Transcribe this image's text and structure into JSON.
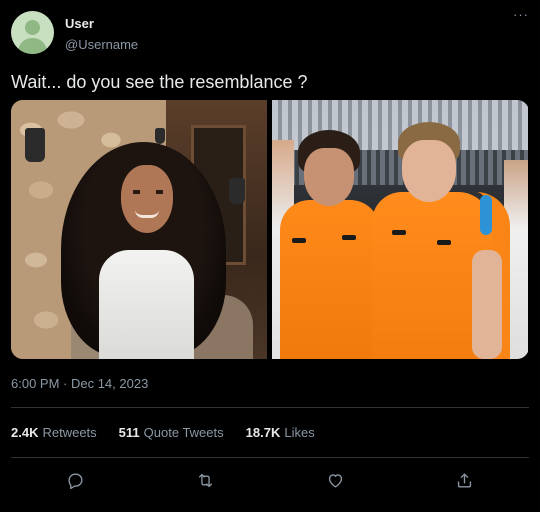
{
  "user": {
    "display_name": "User",
    "handle": "@Username",
    "avatar_icon": "default-avatar-icon"
  },
  "menu": {
    "icon": "more-horizontal-icon",
    "glyph": "···"
  },
  "tweet": {
    "text": "Wait... do you see the resemblance ?",
    "timestamp": "6:00 PM · Dec 14, 2023"
  },
  "stats": {
    "retweets_count": "2.4K",
    "retweets_label": "Retweets",
    "quote_tweets_count": "511",
    "quote_tweets_label": "Quote Tweets",
    "likes_count": "18.7K",
    "likes_label": "Likes"
  },
  "actions": [
    {
      "icon": "reply-icon"
    },
    {
      "icon": "retweet-icon"
    },
    {
      "icon": "like-icon"
    },
    {
      "icon": "share-icon"
    }
  ],
  "colors": {
    "background": "#000000",
    "text_primary": "#e7e9ea",
    "text_secondary": "#8b98a5",
    "divider": "#2f3336"
  }
}
